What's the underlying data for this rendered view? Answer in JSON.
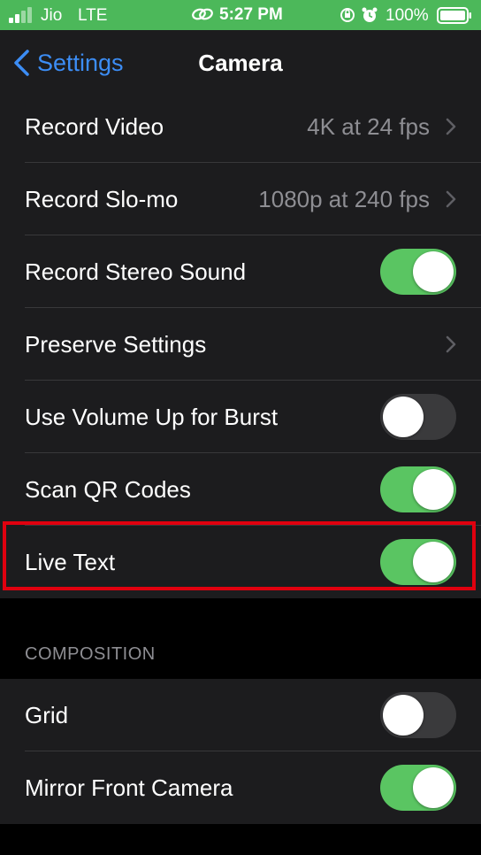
{
  "status_bar": {
    "carrier": "Jio",
    "network": "LTE",
    "time": "5:27 PM",
    "battery": "100%",
    "icons": [
      "signal-icon",
      "hotspot-icon",
      "orientation-lock-icon",
      "alarm-icon",
      "battery-icon"
    ],
    "background": "#4cb85a"
  },
  "nav": {
    "back_label": "Settings",
    "title": "Camera"
  },
  "settings": {
    "record_video": {
      "label": "Record Video",
      "value": "4K at 24 fps"
    },
    "record_slomo": {
      "label": "Record Slo-mo",
      "value": "1080p at 240 fps"
    },
    "stereo_sound": {
      "label": "Record Stereo Sound",
      "enabled": true
    },
    "preserve_settings": {
      "label": "Preserve Settings"
    },
    "volume_burst": {
      "label": "Use Volume Up for Burst",
      "enabled": false
    },
    "scan_qr": {
      "label": "Scan QR Codes",
      "enabled": true
    },
    "live_text": {
      "label": "Live Text",
      "enabled": true
    }
  },
  "composition": {
    "header": "COMPOSITION",
    "grid": {
      "label": "Grid",
      "enabled": false
    },
    "mirror_front": {
      "label": "Mirror Front Camera",
      "enabled": true
    }
  },
  "colors": {
    "toggle_on": "#5ac562",
    "toggle_off": "#3a3a3c",
    "accent": "#3c8df5",
    "highlight": "#e0000f"
  }
}
